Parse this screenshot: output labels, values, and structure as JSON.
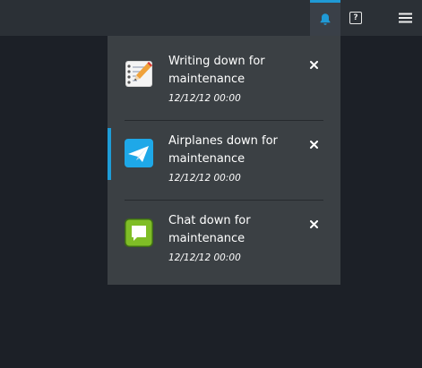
{
  "topbar": {
    "bell_icon": "bell-icon",
    "help_icon": "help-icon",
    "menu_icon": "hamburger-menu-icon",
    "help_label": "?",
    "accent_color": "#1f9ad6"
  },
  "notifications": [
    {
      "title": "Writing down for maintenance",
      "time": "12/12/12 00:00",
      "icon": "notepad-pencil-icon",
      "unread": false
    },
    {
      "title": "Airplanes down for maintenance",
      "time": "12/12/12 00:00",
      "icon": "paper-plane-icon",
      "unread": true
    },
    {
      "title": "Chat down for maintenance",
      "time": "12/12/12 00:00",
      "icon": "chat-bubble-icon",
      "unread": false
    }
  ],
  "colors": {
    "panel_bg": "#3b4044",
    "page_bg": "#1c2027",
    "topbar_bg": "#2b3036",
    "unread_accent": "#1e9cd7"
  }
}
